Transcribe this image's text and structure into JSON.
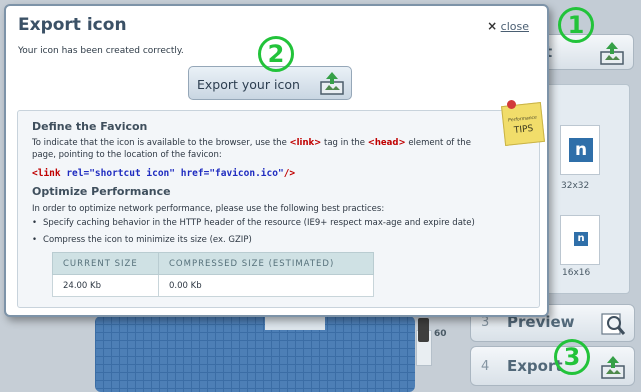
{
  "modal": {
    "title": "Export icon",
    "close_x": "×",
    "close_label": "close",
    "success_message": "Your icon has been created correctly.",
    "export_button_label": "Export your icon"
  },
  "favicon": {
    "heading": "Define the Favicon",
    "desc_1": "To indicate that the icon is available to the browser, use the ",
    "tag_link": "<link>",
    "desc_2": " tag in the ",
    "tag_head": "<head>",
    "desc_3": "  element of the",
    "desc_4": "page, pointing to the location of the favicon:",
    "code_open": "<link ",
    "code_rel": "rel=\"shortcut icon\"",
    "code_space": " ",
    "code_href": "href=\"favicon.ico\"",
    "code_close": "/>"
  },
  "performance": {
    "heading": "Optimize Performance",
    "desc": "In order to optimize network performance, please use the following best practices:",
    "bullets": [
      "Specify caching behavior in the HTTP header of the resource (IE9+ respect max-age and expire date)",
      "Compress the icon to minimize its size (ex. GZIP)"
    ]
  },
  "sizes_table": {
    "headers": [
      "CURRENT SIZE",
      "COMPRESSED SIZE (ESTIMATED)"
    ],
    "rows": [
      [
        "24.00 Kb",
        "0.00 Kb"
      ]
    ]
  },
  "tips_note": {
    "small": "Performance",
    "big": "TIPS"
  },
  "background": {
    "step_top_partial": "t",
    "step3_number": "3",
    "step3_label": "Preview",
    "step4_number": "4",
    "step4_label": "Export",
    "thumb_large_letter": "n",
    "thumb_large_label": "32x32",
    "thumb_small_letter": "n",
    "thumb_small_label": "16x16",
    "slider_value": "60"
  },
  "callouts": [
    "1",
    "2",
    "3"
  ],
  "colors": {
    "accent_green": "#22c33a",
    "code_red": "#c00000",
    "code_blue": "#1f2cc0",
    "icon_blue": "#2f6fa9"
  },
  "icons": [
    "export-icon",
    "magnifier-icon",
    "pushpin-icon",
    "close-icon"
  ]
}
